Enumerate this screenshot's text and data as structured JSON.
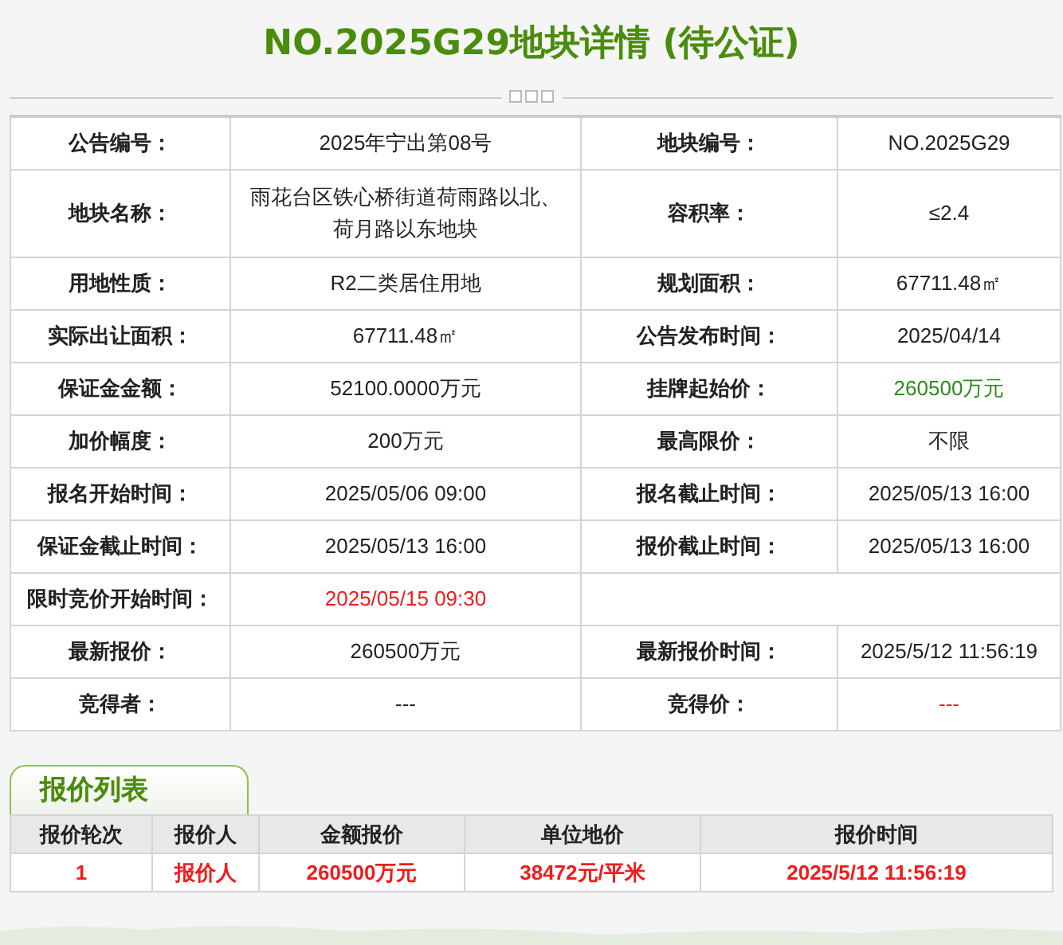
{
  "title": "NO.2025G29地块详情 (待公证)",
  "details": [
    {
      "cells": [
        {
          "label": "公告编号：",
          "value": "2025年宁出第08号",
          "color": "#222222"
        },
        {
          "label": "地块编号：",
          "value": "NO.2025G29",
          "color": "#222222"
        }
      ]
    },
    {
      "cells": [
        {
          "label": "地块名称：",
          "value": "雨花台区铁心桥街道荷雨路以北、荷月路以东地块",
          "color": "#222222"
        },
        {
          "label": "容积率：",
          "value": "≤2.4",
          "color": "#222222"
        }
      ]
    },
    {
      "cells": [
        {
          "label": "用地性质：",
          "value": "R2二类居住用地",
          "color": "#222222"
        },
        {
          "label": "规划面积：",
          "value": "67711.48㎡",
          "color": "#222222"
        }
      ]
    },
    {
      "cells": [
        {
          "label": "实际出让面积：",
          "value": "67711.48㎡",
          "color": "#222222"
        },
        {
          "label": "公告发布时间：",
          "value": "2025/04/14",
          "color": "#222222"
        }
      ]
    },
    {
      "cells": [
        {
          "label": "保证金金额：",
          "value": "52100.0000万元",
          "color": "#222222"
        },
        {
          "label": "挂牌起始价：",
          "value": "260500万元",
          "color": "#2e8b1e"
        }
      ]
    },
    {
      "cells": [
        {
          "label": "加价幅度：",
          "value": "200万元",
          "color": "#222222"
        },
        {
          "label": "最高限价：",
          "value": "不限",
          "color": "#222222"
        }
      ]
    },
    {
      "cells": [
        {
          "label": "报名开始时间：",
          "value": "2025/05/06 09:00",
          "color": "#222222"
        },
        {
          "label": "报名截止时间：",
          "value": "2025/05/13 16:00",
          "color": "#222222"
        }
      ]
    },
    {
      "cells": [
        {
          "label": "保证金截止时间：",
          "value": "2025/05/13 16:00",
          "color": "#222222"
        },
        {
          "label": "报价截止时间：",
          "value": "2025/05/13 16:00",
          "color": "#222222"
        }
      ]
    },
    {
      "cells": [
        {
          "label": "限时竞价开始时间：",
          "value": "2025/05/15 09:30",
          "color": "#f01c1c"
        }
      ]
    },
    {
      "cells": [
        {
          "label": "最新报价：",
          "value": "260500万元",
          "color": "#222222"
        },
        {
          "label": "最新报价时间：",
          "value": "2025/5/12 11:56:19",
          "color": "#222222"
        }
      ]
    },
    {
      "cells": [
        {
          "label": "竞得者：",
          "value": "---",
          "color": "#222222"
        },
        {
          "label": "竞得价：",
          "value": "---",
          "color": "#f01c1c"
        }
      ]
    }
  ],
  "bids": {
    "tab": "报价列表",
    "columns": [
      "报价轮次",
      "报价人",
      "金额报价",
      "单位地价",
      "报价时间"
    ],
    "rows": [
      [
        "1",
        "报价人",
        "260500万元",
        "38472元/平米",
        "2025/5/12 11:56:19"
      ]
    ]
  }
}
